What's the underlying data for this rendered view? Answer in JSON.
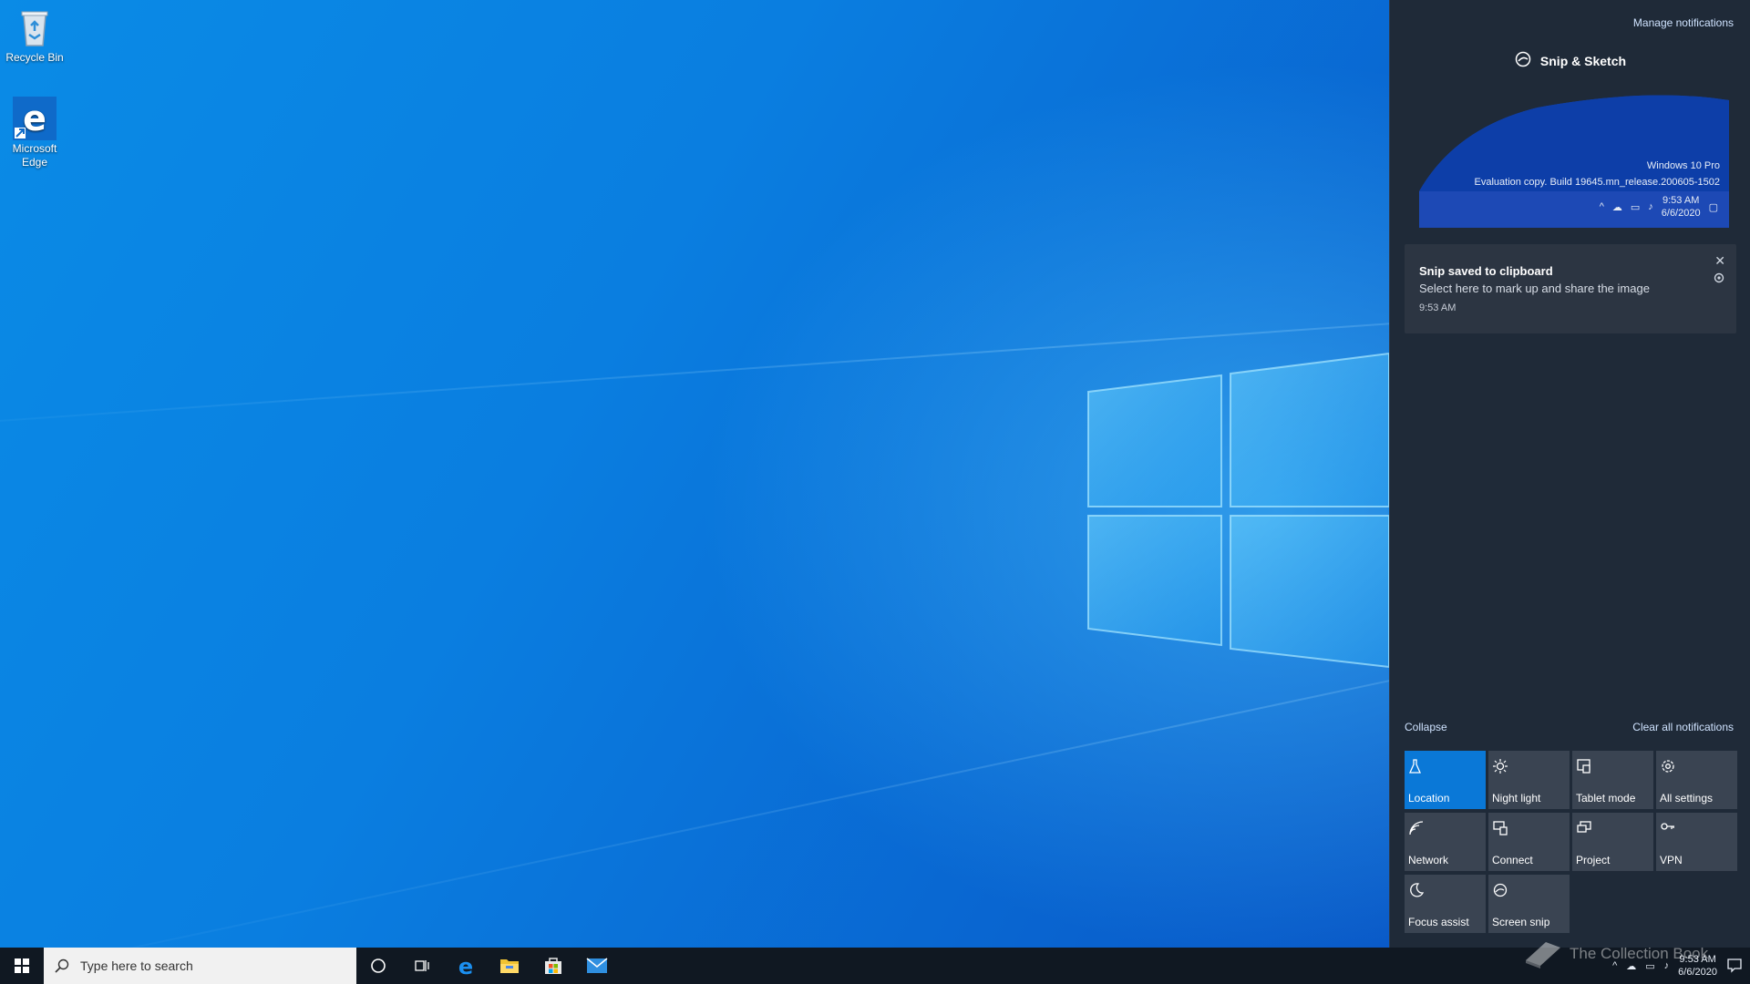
{
  "desktop": {
    "icons": [
      {
        "label": "Recycle Bin"
      },
      {
        "label": "Microsoft Edge"
      }
    ]
  },
  "action_center": {
    "manage_notifications": "Manage notifications",
    "app_group_title": "Snip & Sketch",
    "snip_preview": {
      "watermark_line1": "Windows 10 Pro",
      "watermark_line2": "Evaluation copy. Build 19645.mn_release.200605-1502",
      "time": "9:53 AM",
      "date": "6/6/2020"
    },
    "notification": {
      "title": "Snip saved to clipboard",
      "body": "Select here to mark up and share the image",
      "time": "9:53 AM"
    },
    "collapse_label": "Collapse",
    "clear_all_label": "Clear all notifications",
    "quick_actions": [
      {
        "label": "Location",
        "icon": "location-icon",
        "active": true
      },
      {
        "label": "Night light",
        "icon": "night-light-icon",
        "active": false
      },
      {
        "label": "Tablet mode",
        "icon": "tablet-mode-icon",
        "active": false
      },
      {
        "label": "All settings",
        "icon": "gear-icon",
        "active": false
      },
      {
        "label": "Network",
        "icon": "network-icon",
        "active": false
      },
      {
        "label": "Connect",
        "icon": "connect-icon",
        "active": false
      },
      {
        "label": "Project",
        "icon": "project-icon",
        "active": false
      },
      {
        "label": "VPN",
        "icon": "vpn-icon",
        "active": false
      },
      {
        "label": "Focus assist",
        "icon": "focus-assist-icon",
        "active": false
      },
      {
        "label": "Screen snip",
        "icon": "screen-snip-icon",
        "active": false
      }
    ]
  },
  "taskbar": {
    "search_placeholder": "Type here to search",
    "pinned": [
      "cortana-icon",
      "task-view-icon",
      "edge-icon",
      "file-explorer-icon",
      "store-icon",
      "mail-icon"
    ],
    "clock_time": "9:53 AM",
    "clock_date": "6/6/2020"
  },
  "watermark": "The Collection Book",
  "colors": {
    "accent": "#0a78d7",
    "action_center_bg": "#1f2a38",
    "tile_bg": "#3a4452",
    "taskbar_bg": "#101822"
  }
}
